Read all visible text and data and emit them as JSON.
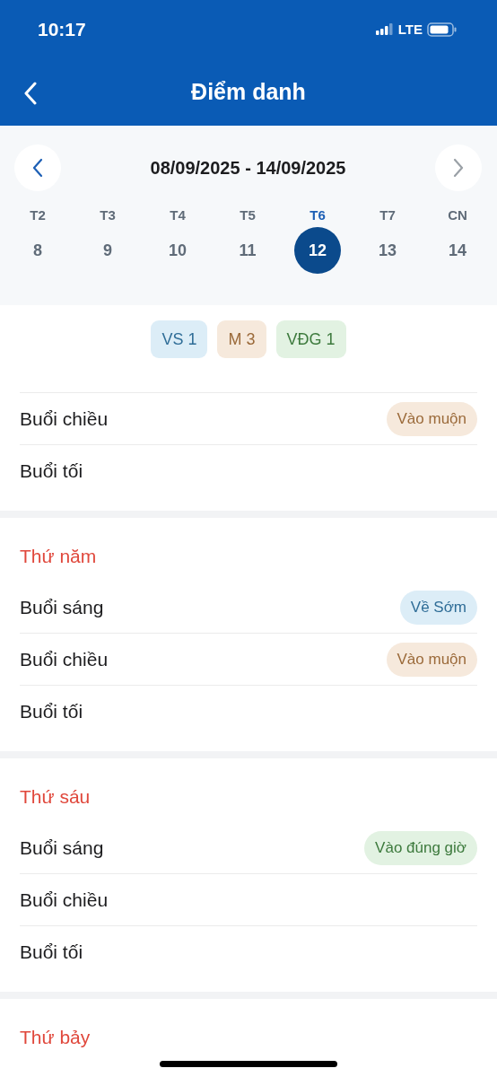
{
  "status_bar": {
    "time": "10:17",
    "network": "LTE"
  },
  "header": {
    "title": "Điểm danh"
  },
  "week": {
    "range": "08/09/2025 - 14/09/2025",
    "days": [
      {
        "label": "T2",
        "date": "8",
        "selected": false
      },
      {
        "label": "T3",
        "date": "9",
        "selected": false
      },
      {
        "label": "T4",
        "date": "10",
        "selected": false
      },
      {
        "label": "T5",
        "date": "11",
        "selected": false
      },
      {
        "label": "T6",
        "date": "12",
        "selected": true
      },
      {
        "label": "T7",
        "date": "13",
        "selected": false
      },
      {
        "label": "CN",
        "date": "14",
        "selected": false
      }
    ]
  },
  "summary": [
    {
      "text": "VS 1",
      "kind": "early"
    },
    {
      "text": "M 3",
      "kind": "late"
    },
    {
      "text": "VĐG 1",
      "kind": "ontime"
    }
  ],
  "sections": [
    {
      "rows": [
        {
          "label": "Buổi chiều",
          "tag": {
            "text": "Vào muộn",
            "kind": "late"
          }
        },
        {
          "label": "Buổi tối"
        }
      ]
    },
    {
      "title": "Thứ năm",
      "rows": [
        {
          "label": "Buổi sáng",
          "tag": {
            "text": "Về Sớm",
            "kind": "early"
          }
        },
        {
          "label": "Buổi chiều",
          "tag": {
            "text": "Vào muộn",
            "kind": "late"
          }
        },
        {
          "label": "Buổi tối"
        }
      ]
    },
    {
      "title": "Thứ sáu",
      "rows": [
        {
          "label": "Buổi sáng",
          "tag": {
            "text": "Vào đúng giờ",
            "kind": "ontime"
          }
        },
        {
          "label": "Buổi chiều"
        },
        {
          "label": "Buổi tối"
        }
      ]
    },
    {
      "title": "Thứ bảy"
    }
  ]
}
